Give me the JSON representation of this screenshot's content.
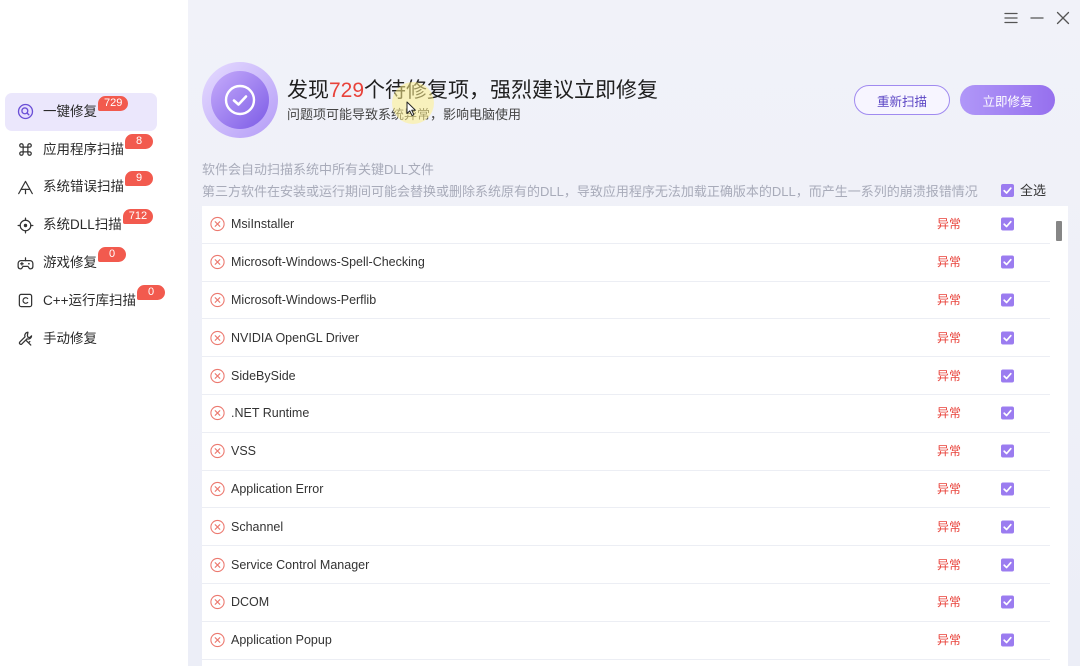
{
  "window_controls": {
    "menu": "menu-icon",
    "minimize": "minimize-icon",
    "close": "close-icon"
  },
  "sidebar": {
    "items": [
      {
        "label": "一键修复",
        "badge": "729",
        "icon": "scan-icon",
        "active": true
      },
      {
        "label": "应用程序扫描",
        "badge": "8",
        "icon": "command-icon",
        "active": false
      },
      {
        "label": "系统错误扫描",
        "badge": "9",
        "icon": "warning-icon",
        "active": false
      },
      {
        "label": "系统DLL扫描",
        "badge": "712",
        "icon": "target-icon",
        "active": false
      },
      {
        "label": "游戏修复",
        "badge": "0",
        "icon": "gamepad-icon",
        "active": false
      },
      {
        "label": "C++运行库扫描",
        "badge": "0",
        "icon": "cpp-box-icon",
        "active": false
      },
      {
        "label": "手动修复",
        "icon": "wrench-icon",
        "active": false
      }
    ]
  },
  "header": {
    "icon": "check-circle-icon",
    "title_prefix": "发现",
    "issue_count": "729",
    "title_suffix": "个待修复项，强烈建议立即修复",
    "subtitle": "问题项可能导致系统异常，影响电脑使用",
    "rescan_label": "重新扫描",
    "fix_label": "立即修复"
  },
  "info": {
    "line1": "软件会自动扫描系统中所有关键DLL文件",
    "line2": "第三方软件在安装或运行期间可能会替换或删除系统原有的DLL，导致应用程序无法加载正确版本的DLL，而产生一系列的崩溃报错情况",
    "select_all_label": "全选",
    "select_all_checked": true
  },
  "items": [
    {
      "name": "MsiInstaller",
      "status": "异常",
      "checked": true
    },
    {
      "name": "Microsoft-Windows-Spell-Checking",
      "status": "异常",
      "checked": true
    },
    {
      "name": "Microsoft-Windows-Perflib",
      "status": "异常",
      "checked": true
    },
    {
      "name": "NVIDIA OpenGL Driver",
      "status": "异常",
      "checked": true
    },
    {
      "name": "SideBySide",
      "status": "异常",
      "checked": true
    },
    {
      "name": ".NET Runtime",
      "status": "异常",
      "checked": true
    },
    {
      "name": "VSS",
      "status": "异常",
      "checked": true
    },
    {
      "name": "Application Error",
      "status": "异常",
      "checked": true
    },
    {
      "name": "Schannel",
      "status": "异常",
      "checked": true
    },
    {
      "name": "Service Control Manager",
      "status": "异常",
      "checked": true
    },
    {
      "name": "DCOM",
      "status": "异常",
      "checked": true
    },
    {
      "name": "Application Popup",
      "status": "异常",
      "checked": true
    }
  ],
  "colors": {
    "accent": "#9b7cf0",
    "danger": "#e8423a",
    "badge": "#f25a4e"
  }
}
